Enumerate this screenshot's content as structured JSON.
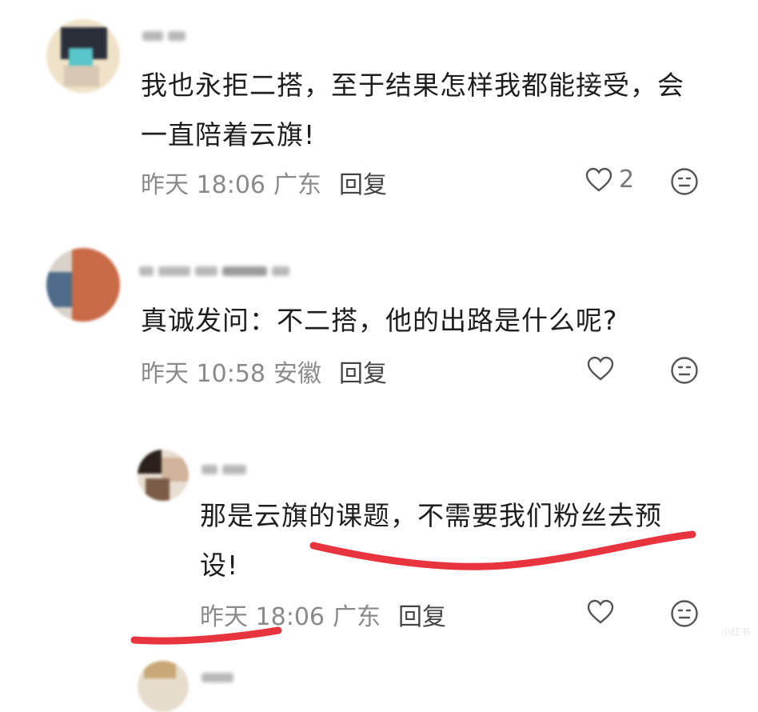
{
  "comments": [
    {
      "text_line1": "我也永拒二搭，至于结果怎样我都能接受，会",
      "text_line2": "一直陪着云旗!",
      "time": "昨天 18:06",
      "location": "广东",
      "reply_label": "回复",
      "likes": "2"
    },
    {
      "text_line1": "真诚发问：不二搭，他的出路是什么呢?",
      "time": "昨天 10:58",
      "location": "安徽",
      "reply_label": "回复",
      "likes": ""
    },
    {
      "text_line1": "那是云旗的课题，不需要我们粉丝去预",
      "text_line2": "设!",
      "time": "昨天 18:06",
      "location": "广东",
      "reply_label": "回复",
      "likes": ""
    }
  ],
  "annotation_color": "#e8343f",
  "watermark": "小红书"
}
